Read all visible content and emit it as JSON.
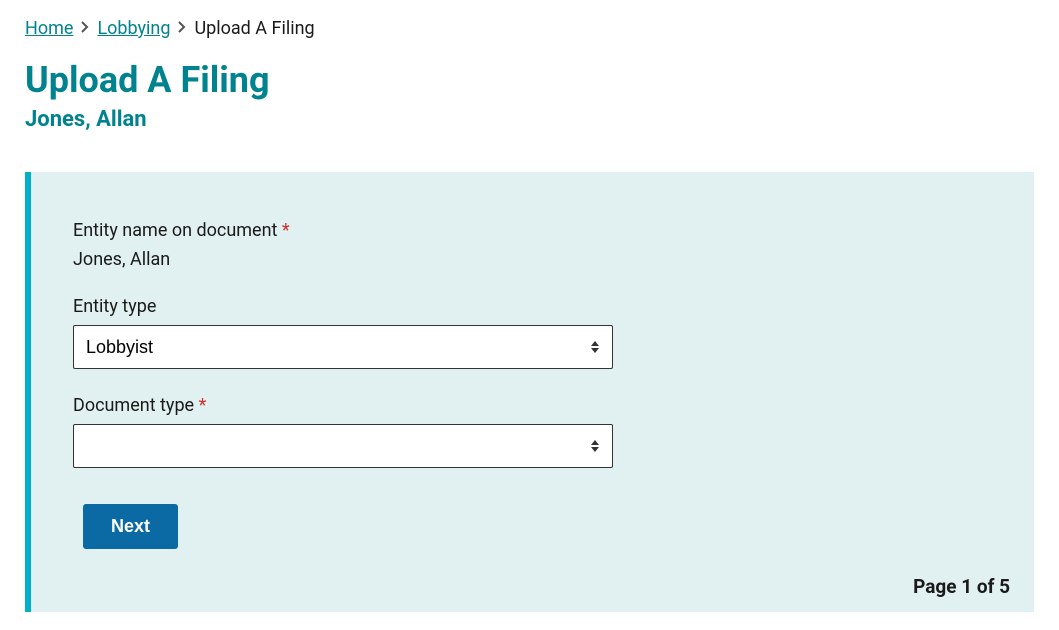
{
  "breadcrumb": {
    "home": "Home",
    "lobbying": "Lobbying",
    "current": "Upload A Filing"
  },
  "title": "Upload A Filing",
  "subtitle": "Jones, Allan",
  "form": {
    "entity_name_label": "Entity name on document",
    "entity_name_value": "Jones, Allan",
    "entity_type_label": "Entity type",
    "entity_type_value": "Lobbyist",
    "document_type_label": "Document type",
    "document_type_value": "",
    "next_label": "Next"
  },
  "pagination": "Page 1 of 5",
  "required_marker": "*"
}
